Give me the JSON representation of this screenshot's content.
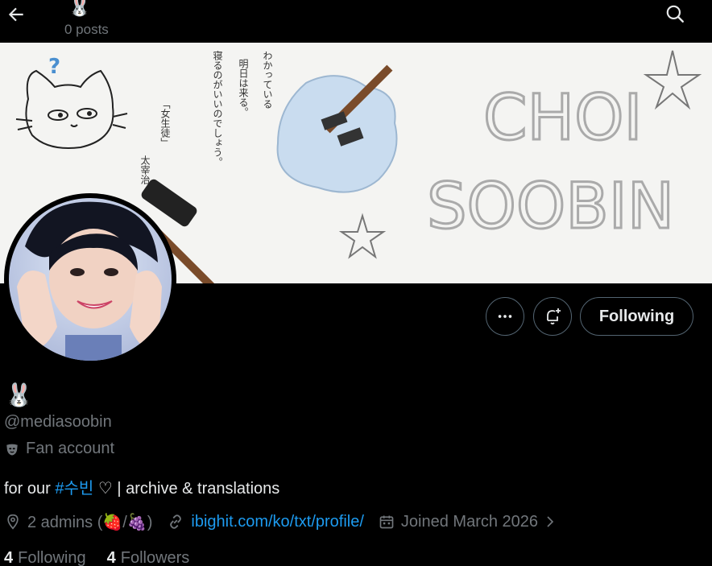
{
  "header": {
    "title_emoji": "🐰",
    "post_count": "0 posts"
  },
  "banner": {
    "text_line1": "CHOI",
    "text_line2": "SOOBIN",
    "jp_col1": "わかっている",
    "jp_col2": "明日は来る。",
    "jp_col3": "寝るのがいいのでしょう。",
    "jp_title": "「女生徒」",
    "jp_author": "太宰治"
  },
  "actions": {
    "following_label": "Following"
  },
  "profile": {
    "name": "🐰",
    "handle": "@mediasoobin",
    "account_type": "Fan account",
    "bio_pre": "for our ",
    "bio_tag": "#수빈",
    "bio_post": " ♡ | archive & translations",
    "location": "2 admins (🍓/🍇)",
    "website": "ibighit.com/ko/txt/profile/",
    "joined": "Joined March 2026"
  },
  "stats": {
    "following_count": "4",
    "following_label": "Following",
    "followers_count": "4",
    "followers_label": "Followers"
  },
  "colors": {
    "accent": "#1d9bf0",
    "muted": "#71767b",
    "text": "#e7e9ea"
  }
}
